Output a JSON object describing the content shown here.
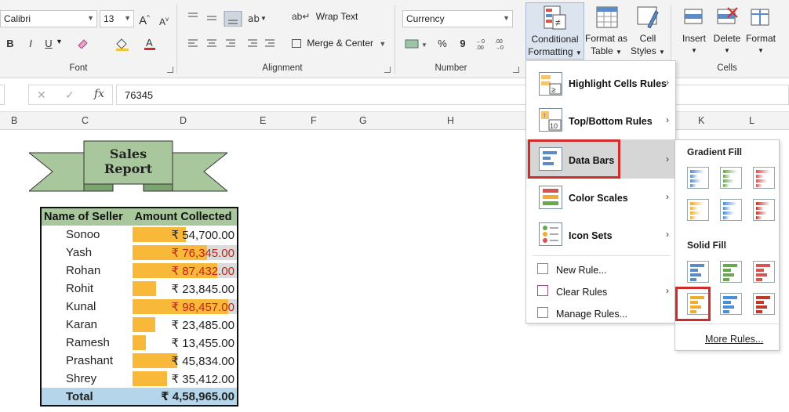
{
  "ribbon": {
    "font_name": "Calibri",
    "font_size": "13",
    "grow_font": "A",
    "shrink_font": "A",
    "bold": "B",
    "italic": "I",
    "underline": "U",
    "font_color_letter": "A",
    "font_group": "Font",
    "wrap_text": "Wrap Text",
    "merge_center": "Merge & Center",
    "alignment_group": "Alignment",
    "number_format": "Currency",
    "percent": "%",
    "comma": "9",
    "number_group": "Number",
    "cond_fmt_line1": "Conditional",
    "cond_fmt_line2": "Formatting",
    "format_table_line1": "Format as",
    "format_table_line2": "Table",
    "cell_styles_line1": "Cell",
    "cell_styles_line2": "Styles",
    "insert": "Insert",
    "delete": "Delete",
    "format": "Format",
    "cells_group": "Cells"
  },
  "formula_bar": {
    "fx": "fx",
    "value": "76345"
  },
  "columns": [
    "B",
    "C",
    "D",
    "E",
    "F",
    "G",
    "H",
    "K",
    "L"
  ],
  "banner": {
    "title": "Sales Report"
  },
  "table": {
    "header_name": "Name of Seller",
    "header_amount": "Amount Collected",
    "rows": [
      {
        "name": "Sonoo",
        "amount": "₹ 54,700.00",
        "fraction": 0.556,
        "highlight": false
      },
      {
        "name": "Yash",
        "amount": "₹ 76,345.00",
        "fraction": 0.775,
        "highlight": true
      },
      {
        "name": "Rohan",
        "amount": "₹ 87,432.00",
        "fraction": 0.888,
        "highlight": true
      },
      {
        "name": "Rohit",
        "amount": "₹ 23,845.00",
        "fraction": 0.242,
        "highlight": false
      },
      {
        "name": "Kunal",
        "amount": "₹ 98,457.00",
        "fraction": 1.0,
        "highlight": true
      },
      {
        "name": "Karan",
        "amount": "₹ 23,485.00",
        "fraction": 0.239,
        "highlight": false
      },
      {
        "name": "Ramesh",
        "amount": "₹ 13,455.00",
        "fraction": 0.137,
        "highlight": false
      },
      {
        "name": "Prashant",
        "amount": "₹ 45,834.00",
        "fraction": 0.466,
        "highlight": false
      },
      {
        "name": "Shrey",
        "amount": "₹ 35,412.00",
        "fraction": 0.36,
        "highlight": false
      }
    ],
    "total_label": "Total",
    "total_amount": "₹ 4,58,965.00"
  },
  "cf_menu": {
    "highlight": "Highlight Cells Rules",
    "topbottom": "Top/Bottom Rules",
    "databars": "Data Bars",
    "colorscales": "Color Scales",
    "iconsets": "Icon Sets",
    "newrule": "New Rule...",
    "clearrules": "Clear Rules",
    "managerules": "Manage Rules...",
    "topbottom_icon_num": "10"
  },
  "databars_menu": {
    "gradient": "Gradient Fill",
    "solid": "Solid Fill",
    "more": "More Rules...",
    "colors": [
      "#5b8bc9",
      "#6aa84f",
      "#d9534f",
      "#f0ad2e",
      "#4a90d9",
      "#c0392b"
    ]
  }
}
